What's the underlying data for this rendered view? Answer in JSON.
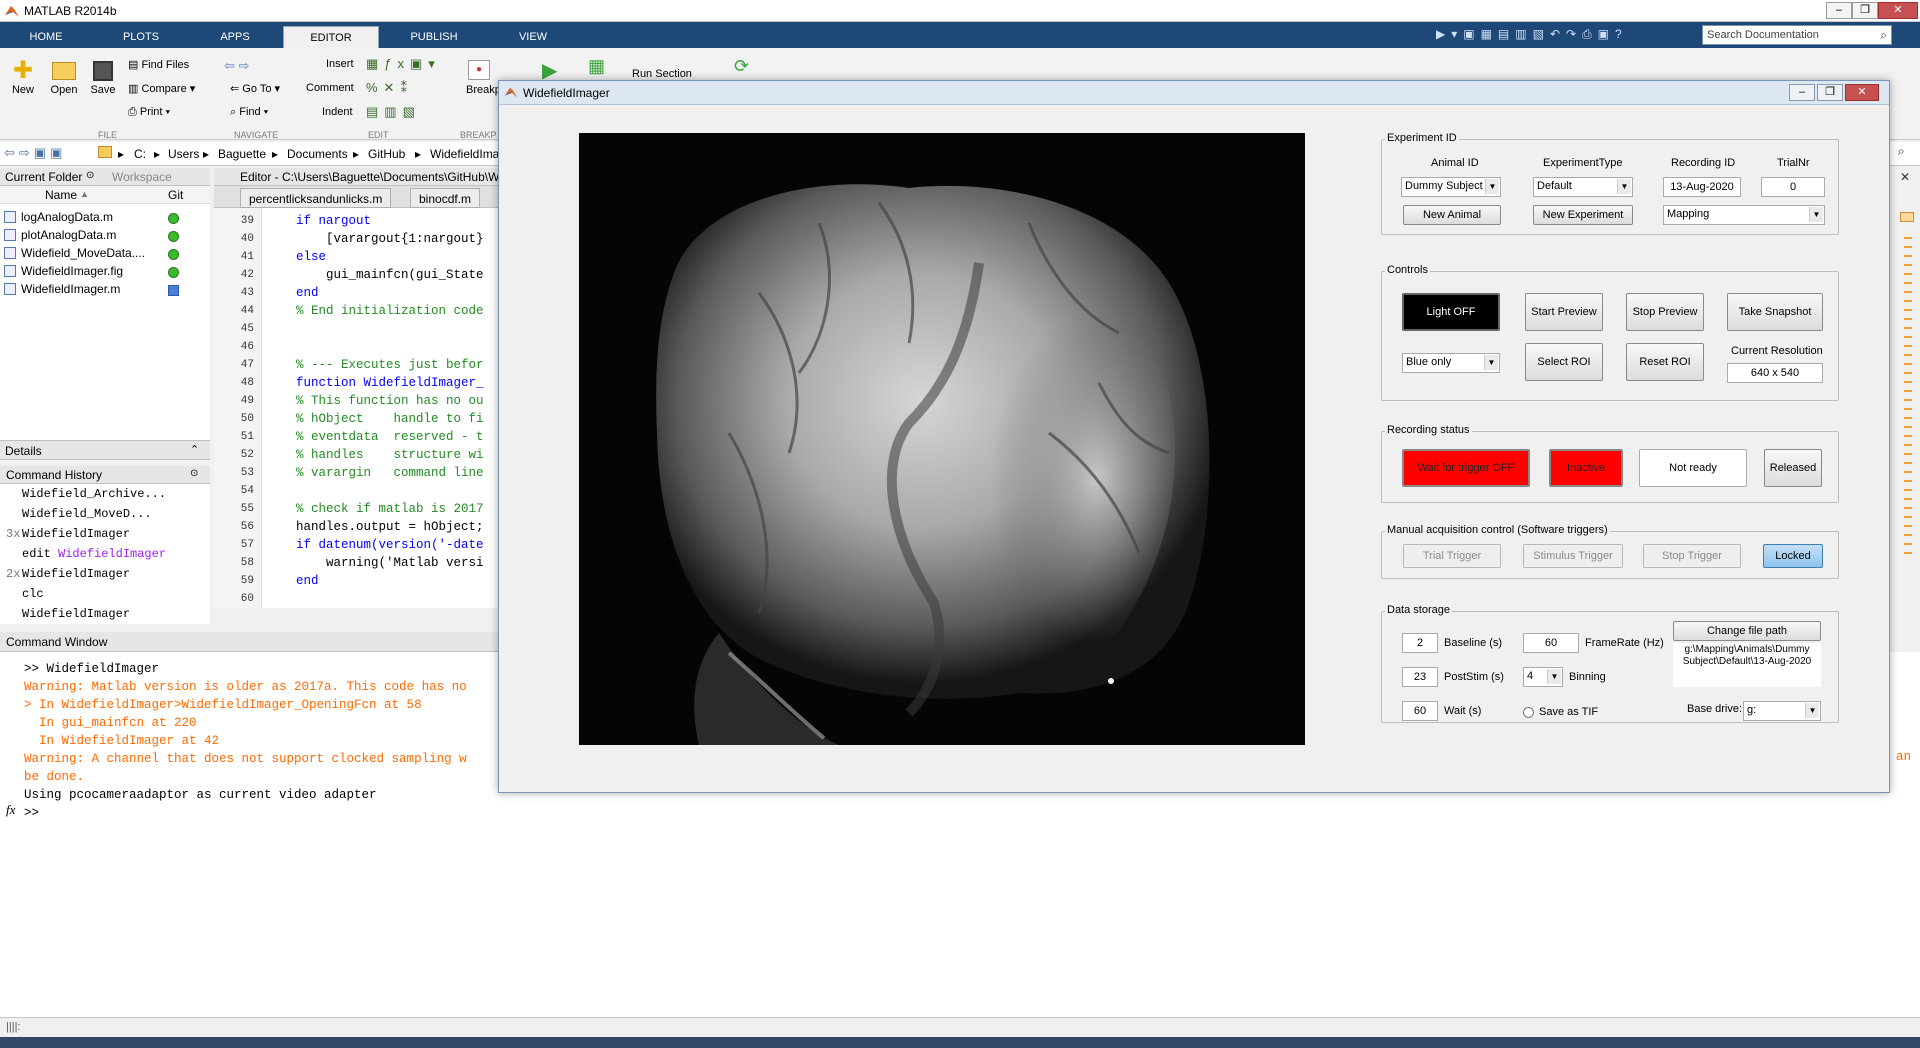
{
  "app": {
    "title": "MATLAB R2014b"
  },
  "ribbon": {
    "tabs": [
      "HOME",
      "PLOTS",
      "APPS",
      "EDITOR",
      "PUBLISH",
      "VIEW"
    ],
    "active_tab": "EDITOR",
    "search_placeholder": "Search Documentation",
    "file": {
      "new": "New",
      "open": "Open",
      "save": "Save",
      "find_files": "Find Files",
      "compare": "Compare",
      "print": "Print",
      "group": "FILE"
    },
    "navigate": {
      "goto": "Go To",
      "find": "Find",
      "group": "NAVIGATE"
    },
    "edit": {
      "insert": "Insert",
      "comment": "Comment",
      "indent": "Indent",
      "group": "EDIT"
    },
    "breakpoints": {
      "label": "Breakp",
      "group": "BREAKP"
    },
    "run": {
      "run_section": "Run Section"
    }
  },
  "address": {
    "crumbs": [
      "C:",
      "Users",
      "Baguette",
      "Documents",
      "GitHub",
      "WidefieldIma"
    ]
  },
  "current_folder": {
    "tab": "Current Folder",
    "tab2": "Workspace",
    "col_name": "Name",
    "col_git": "Git",
    "files": [
      "logAnalogData.m",
      "plotAnalogData.m",
      "Widefield_MoveData....",
      "WidefieldImager.fig",
      "WidefieldImager.m"
    ]
  },
  "details": {
    "label": "Details"
  },
  "command_history": {
    "label": "Command History",
    "items": [
      {
        "prefix": "",
        "text": "Widefield_Archive..."
      },
      {
        "prefix": "",
        "text": "Widefield_MoveD..."
      },
      {
        "prefix": "3x",
        "text": "WidefieldImager"
      },
      {
        "prefix": "",
        "text": "edit ",
        "link": "WidefieldImager"
      },
      {
        "prefix": "2x",
        "text": "WidefieldImager"
      },
      {
        "prefix": "",
        "text": "clc"
      },
      {
        "prefix": "",
        "text": "WidefieldImager"
      }
    ]
  },
  "editor": {
    "path": "Editor - C:\\Users\\Baguette\\Documents\\GitHub\\W",
    "tabs": [
      "percentlicksandunlicks.m",
      "binocdf.m"
    ],
    "lines": [
      {
        "n": "39",
        "code": "if nargout"
      },
      {
        "n": "40",
        "code": "    [varargout{1:nargout}"
      },
      {
        "n": "41",
        "code": "else"
      },
      {
        "n": "42",
        "code": "    gui_mainfcn(gui_State"
      },
      {
        "n": "43",
        "code": "end"
      },
      {
        "n": "44",
        "code": "% End initialization code"
      },
      {
        "n": "45",
        "code": ""
      },
      {
        "n": "46",
        "code": ""
      },
      {
        "n": "47",
        "code": "% --- Executes just befor"
      },
      {
        "n": "48",
        "code": "function WidefieldImager_"
      },
      {
        "n": "49",
        "code": "% This function has no ou"
      },
      {
        "n": "50",
        "code": "% hObject    handle to fi"
      },
      {
        "n": "51",
        "code": "% eventdata  reserved - t"
      },
      {
        "n": "52",
        "code": "% handles    structure wi"
      },
      {
        "n": "53",
        "code": "% varargin   command line"
      },
      {
        "n": "54",
        "code": ""
      },
      {
        "n": "55",
        "code": "% check if matlab is 2017"
      },
      {
        "n": "56",
        "code": "handles.output = hObject;"
      },
      {
        "n": "57",
        "code": "if datenum(version('-date"
      },
      {
        "n": "58",
        "code": "    warning('Matlab versi"
      },
      {
        "n": "59",
        "code": "end"
      },
      {
        "n": "60",
        "code": ""
      }
    ]
  },
  "command_window": {
    "label": "Command Window",
    "lines": [
      {
        "kind": "plain",
        "text": ">> WidefieldImager"
      },
      {
        "kind": "warn",
        "text": "Warning: Matlab version is older as 2017a. This code has no"
      },
      {
        "kind": "link",
        "text": "> In WidefieldImager>WidefieldImager_OpeningFcn at 58"
      },
      {
        "kind": "link",
        "text": "  In gui_mainfcn at 220"
      },
      {
        "kind": "link",
        "text": "  In WidefieldImager at 42"
      },
      {
        "kind": "warn",
        "text": "Warning: A channel that does not support clocked sampling w"
      },
      {
        "kind": "warn",
        "text": "be done."
      },
      {
        "kind": "plain",
        "text": "Using pcocameraadaptor as current video adapter"
      },
      {
        "kind": "prompt",
        "text": ">>"
      }
    ],
    "overflow_right": "an"
  },
  "gui": {
    "title": "WidefieldImager",
    "experiment": {
      "title": "Experiment ID",
      "animal_label": "Animal ID",
      "animal_value": "Dummy Subject",
      "exptype_label": "ExperimentType",
      "exptype_value": "Default",
      "recording_label": "Recording ID",
      "recording_value": "13-Aug-2020",
      "trial_label": "TrialNr",
      "trial_value": "0",
      "new_animal": "New Animal",
      "new_experiment": "New Experiment",
      "mode_value": "Mapping"
    },
    "controls": {
      "title": "Controls",
      "light_off": "Light OFF",
      "start_preview": "Start Preview",
      "stop_preview": "Stop Preview",
      "take_snapshot": "Take Snapshot",
      "color_value": "Blue only",
      "select_roi": "Select ROI",
      "reset_roi": "Reset ROI",
      "res_label": "Current Resolution",
      "res_value": "640 x 540"
    },
    "recording": {
      "title": "Recording status",
      "wait": "Wait for trigger OFF",
      "inactive": "Inactive",
      "not_ready": "Not ready",
      "released": "Released"
    },
    "manual": {
      "title": "Manual acquisition control (Software triggers)",
      "trial": "Trial Trigger",
      "stimulus": "Stimulus Trigger",
      "stop": "Stop Trigger",
      "locked": "Locked"
    },
    "storage": {
      "title": "Data storage",
      "baseline_value": "2",
      "baseline_label": "Baseline (s)",
      "framerate_value": "60",
      "framerate_label": "FrameRate (Hz)",
      "poststim_value": "23",
      "poststim_label": "PostStim (s)",
      "binning_value": "4",
      "binning_label": "Binning",
      "wait_value": "60",
      "wait_label": "Wait (s)",
      "save_tif": "Save as TIF",
      "change_path": "Change file path",
      "path_text": "g:\\Mapping\\Animals\\Dummy Subject\\Default\\13-Aug-2020",
      "base_drive_label": "Base drive:",
      "base_drive_value": "g:"
    }
  },
  "colors": {
    "ribbon_bg": "#1e4877",
    "warn": "#ff6a00",
    "keyword": "#0000ff",
    "comment": "#228b22",
    "status_red": "#ff0000"
  }
}
